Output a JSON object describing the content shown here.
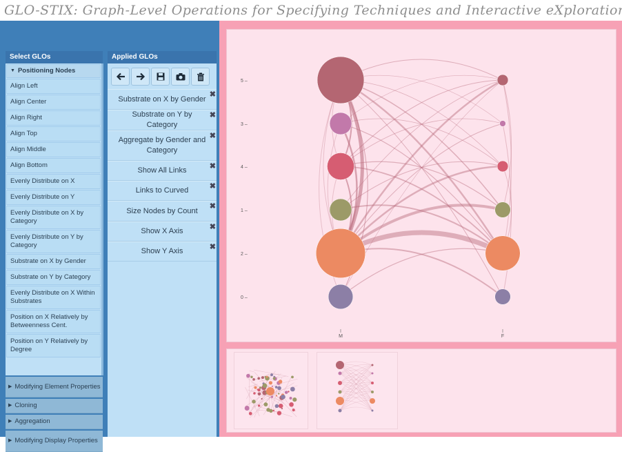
{
  "app_title": "GLO-STIX: Graph-Level Operations for Specifying Techniques and Interactive eXploration",
  "select_panel": {
    "title": "Select GLOs",
    "group_positioning": "Positioning Nodes",
    "positioning_items": [
      "Align Left",
      "Align Center",
      "Align Right",
      "Align Top",
      "Align Middle",
      "Align Bottom",
      "Evenly Distribute on X",
      "Evenly Distribute on Y",
      "Evenly Distribute on X by Category",
      "Evenly Distribute on Y by Category",
      "Substrate on X by Gender",
      "Substrate on Y by Category",
      "Evenly Distribute on X Within Substrates",
      "Position on X Relatively by Betweenness Cent.",
      "Position on Y Relatively by Degree"
    ],
    "collapsed_groups": [
      "Modifying Element Properties",
      "Cloning",
      "Aggregation",
      "Modifying Display Properties"
    ]
  },
  "applied_panel": {
    "title": "Applied GLOs",
    "toolbar": [
      "back-arrow-icon",
      "forward-arrow-icon",
      "save-icon",
      "camera-icon",
      "trash-icon"
    ],
    "items": [
      "Substrate on X by Gender",
      "Substrate on Y by Category",
      "Aggregate by Gender and Category",
      "Show All Links",
      "Links to Curved",
      "Size Nodes by Count",
      "Show X Axis",
      "Show Y Axis"
    ],
    "remove_symbol": "✖"
  },
  "graph": {
    "y_axis_labels": [
      "5",
      "3",
      "4",
      "1",
      "2",
      "0"
    ],
    "x_axis_labels": [
      "M",
      "F"
    ],
    "category_colors": [
      "#b46672",
      "#c279aa",
      "#d65d72",
      "#9c9a68",
      "#ec8a62",
      "#8c7fa6"
    ],
    "link_color": "#b96a7c",
    "m_node_counts": [
      18,
      4,
      6,
      4,
      20,
      5
    ],
    "f_node_counts": [
      1,
      0.3,
      1,
      2,
      10,
      2
    ]
  },
  "colors": {
    "panel_blue": "#3f7fb8",
    "frame_pink": "#f7a1b5",
    "canvas_pink": "#fde3ec"
  }
}
